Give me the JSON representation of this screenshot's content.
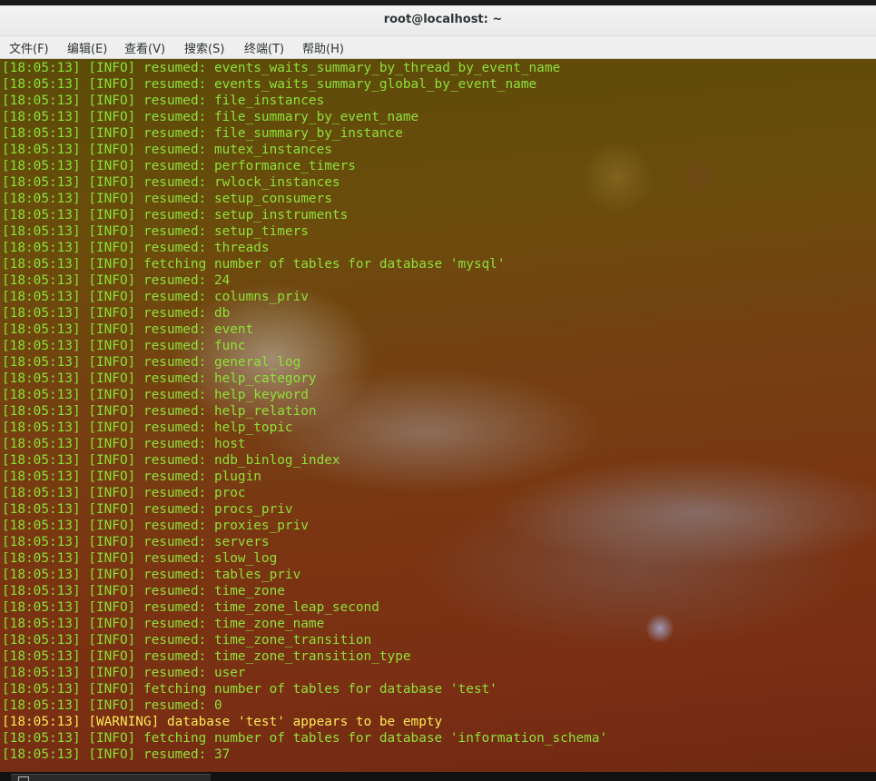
{
  "window": {
    "title": "root@localhost: ~"
  },
  "menu": [
    {
      "label": "文件(F)"
    },
    {
      "label": "编辑(E)"
    },
    {
      "label": "查看(V)"
    },
    {
      "label": "搜索(S)"
    },
    {
      "label": "终端(T)"
    },
    {
      "label": "帮助(H)"
    }
  ],
  "terminal": {
    "colors": {
      "info": "#8ae234",
      "warning": "#fce94f"
    },
    "lines": [
      {
        "time": "[18:05:13]",
        "level": "[INFO]",
        "msg": "resumed: events_waits_summary_by_thread_by_event_name",
        "type": "info"
      },
      {
        "time": "[18:05:13]",
        "level": "[INFO]",
        "msg": "resumed: events_waits_summary_global_by_event_name",
        "type": "info"
      },
      {
        "time": "[18:05:13]",
        "level": "[INFO]",
        "msg": "resumed: file_instances",
        "type": "info"
      },
      {
        "time": "[18:05:13]",
        "level": "[INFO]",
        "msg": "resumed: file_summary_by_event_name",
        "type": "info"
      },
      {
        "time": "[18:05:13]",
        "level": "[INFO]",
        "msg": "resumed: file_summary_by_instance",
        "type": "info"
      },
      {
        "time": "[18:05:13]",
        "level": "[INFO]",
        "msg": "resumed: mutex_instances",
        "type": "info"
      },
      {
        "time": "[18:05:13]",
        "level": "[INFO]",
        "msg": "resumed: performance_timers",
        "type": "info"
      },
      {
        "time": "[18:05:13]",
        "level": "[INFO]",
        "msg": "resumed: rwlock_instances",
        "type": "info"
      },
      {
        "time": "[18:05:13]",
        "level": "[INFO]",
        "msg": "resumed: setup_consumers",
        "type": "info"
      },
      {
        "time": "[18:05:13]",
        "level": "[INFO]",
        "msg": "resumed: setup_instruments",
        "type": "info"
      },
      {
        "time": "[18:05:13]",
        "level": "[INFO]",
        "msg": "resumed: setup_timers",
        "type": "info"
      },
      {
        "time": "[18:05:13]",
        "level": "[INFO]",
        "msg": "resumed: threads",
        "type": "info"
      },
      {
        "time": "[18:05:13]",
        "level": "[INFO]",
        "msg": "fetching number of tables for database 'mysql'",
        "type": "info"
      },
      {
        "time": "[18:05:13]",
        "level": "[INFO]",
        "msg": "resumed: 24",
        "type": "info"
      },
      {
        "time": "[18:05:13]",
        "level": "[INFO]",
        "msg": "resumed: columns_priv",
        "type": "info"
      },
      {
        "time": "[18:05:13]",
        "level": "[INFO]",
        "msg": "resumed: db",
        "type": "info"
      },
      {
        "time": "[18:05:13]",
        "level": "[INFO]",
        "msg": "resumed: event",
        "type": "info"
      },
      {
        "time": "[18:05:13]",
        "level": "[INFO]",
        "msg": "resumed: func",
        "type": "info"
      },
      {
        "time": "[18:05:13]",
        "level": "[INFO]",
        "msg": "resumed: general_log",
        "type": "info"
      },
      {
        "time": "[18:05:13]",
        "level": "[INFO]",
        "msg": "resumed: help_category",
        "type": "info"
      },
      {
        "time": "[18:05:13]",
        "level": "[INFO]",
        "msg": "resumed: help_keyword",
        "type": "info"
      },
      {
        "time": "[18:05:13]",
        "level": "[INFO]",
        "msg": "resumed: help_relation",
        "type": "info"
      },
      {
        "time": "[18:05:13]",
        "level": "[INFO]",
        "msg": "resumed: help_topic",
        "type": "info"
      },
      {
        "time": "[18:05:13]",
        "level": "[INFO]",
        "msg": "resumed: host",
        "type": "info"
      },
      {
        "time": "[18:05:13]",
        "level": "[INFO]",
        "msg": "resumed: ndb_binlog_index",
        "type": "info"
      },
      {
        "time": "[18:05:13]",
        "level": "[INFO]",
        "msg": "resumed: plugin",
        "type": "info"
      },
      {
        "time": "[18:05:13]",
        "level": "[INFO]",
        "msg": "resumed: proc",
        "type": "info"
      },
      {
        "time": "[18:05:13]",
        "level": "[INFO]",
        "msg": "resumed: procs_priv",
        "type": "info"
      },
      {
        "time": "[18:05:13]",
        "level": "[INFO]",
        "msg": "resumed: proxies_priv",
        "type": "info"
      },
      {
        "time": "[18:05:13]",
        "level": "[INFO]",
        "msg": "resumed: servers",
        "type": "info"
      },
      {
        "time": "[18:05:13]",
        "level": "[INFO]",
        "msg": "resumed: slow_log",
        "type": "info"
      },
      {
        "time": "[18:05:13]",
        "level": "[INFO]",
        "msg": "resumed: tables_priv",
        "type": "info"
      },
      {
        "time": "[18:05:13]",
        "level": "[INFO]",
        "msg": "resumed: time_zone",
        "type": "info"
      },
      {
        "time": "[18:05:13]",
        "level": "[INFO]",
        "msg": "resumed: time_zone_leap_second",
        "type": "info"
      },
      {
        "time": "[18:05:13]",
        "level": "[INFO]",
        "msg": "resumed: time_zone_name",
        "type": "info"
      },
      {
        "time": "[18:05:13]",
        "level": "[INFO]",
        "msg": "resumed: time_zone_transition",
        "type": "info"
      },
      {
        "time": "[18:05:13]",
        "level": "[INFO]",
        "msg": "resumed: time_zone_transition_type",
        "type": "info"
      },
      {
        "time": "[18:05:13]",
        "level": "[INFO]",
        "msg": "resumed: user",
        "type": "info"
      },
      {
        "time": "[18:05:13]",
        "level": "[INFO]",
        "msg": "fetching number of tables for database 'test'",
        "type": "info"
      },
      {
        "time": "[18:05:13]",
        "level": "[INFO]",
        "msg": "resumed: 0",
        "type": "info"
      },
      {
        "time": "[18:05:13]",
        "level": "[WARNING]",
        "msg": "database 'test' appears to be empty",
        "type": "warning"
      },
      {
        "time": "[18:05:13]",
        "level": "[INFO]",
        "msg": "fetching number of tables for database 'information_schema'",
        "type": "info"
      },
      {
        "time": "[18:05:13]",
        "level": "[INFO]",
        "msg": "resumed: 37",
        "type": "info"
      }
    ]
  }
}
